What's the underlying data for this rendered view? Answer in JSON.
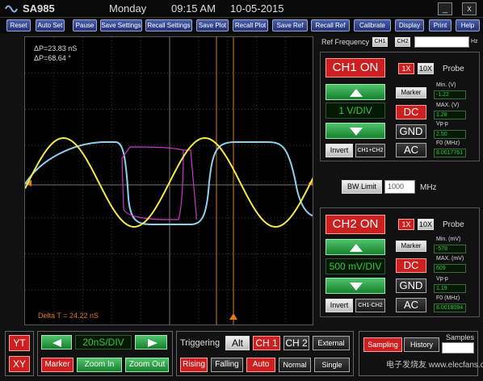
{
  "app": {
    "name": "SA985",
    "day": "Monday",
    "time": "09:15 AM",
    "date": "10-05-2015"
  },
  "window": {
    "minimize": "_",
    "close": "x"
  },
  "toolbar": [
    "Reset",
    "Auto Set",
    "Pause",
    "Save Settings",
    "Recall Settings",
    "Save Plot",
    "Recall Plot",
    "Save Ref",
    "Recall Ref",
    "Calibrate",
    "Display",
    "Print",
    "Help"
  ],
  "scope": {
    "delta_p_time": "ΔP=23.83  nS",
    "delta_p_phase": "ΔP=68.64 °",
    "delta_t": "Delta T = 24.22 nS"
  },
  "ref_frequency": {
    "label": "Ref Frequency",
    "ch1": "CH1",
    "ch2": "CH2",
    "value": "",
    "unit": "Hz"
  },
  "ch1": {
    "on_label": "CH1 ON",
    "probe_1x": "1X",
    "probe_10x": "10X",
    "probe_label": "Probe",
    "volts_div": "1 V/DIV",
    "marker": "Marker",
    "coupling_dc": "DC",
    "coupling_gnd": "GND",
    "coupling_ac": "AC",
    "invert": "Invert",
    "math": "CH1+CH2",
    "min_label": "Min. (V)",
    "min_value": "-1.22",
    "max_label": "MAX. (V)",
    "max_value": "1.28",
    "vpp_label": "Vp-p",
    "vpp_value": "2.50",
    "f0_label": "F0 (MHz)",
    "f0_value": "8.0017761"
  },
  "bw_limit": {
    "label": "BW Limit",
    "value": "1000",
    "unit": "MHz"
  },
  "ch2": {
    "on_label": "CH2 ON",
    "probe_1x": "1X",
    "probe_10x": "10X",
    "probe_label": "Probe",
    "volts_div": "500 mV/DIV",
    "marker": "Marker",
    "coupling_dc": "DC",
    "coupling_gnd": "GND",
    "coupling_ac": "AC",
    "invert": "Invert",
    "math": "CH1-CH2",
    "min_label": "Min. (mV)",
    "min_value": "-578",
    "max_label": "MAX. (mV)",
    "max_value": "609",
    "vpp_label": "Vp-p",
    "vpp_value": "1.19",
    "f0_label": "F0 (MHz)",
    "f0_value": "8.0018094"
  },
  "bottom": {
    "yt": "YT",
    "xy": "XY",
    "timebase": "20nS/DIV",
    "marker": "Marker",
    "zoom_in": "Zoom In",
    "zoom_out": "Zoom Out",
    "triggering_label": "Triggering",
    "alt": "Alt",
    "trig_ch1": "CH 1",
    "trig_ch2": "CH 2",
    "external": "External",
    "rising": "Rising",
    "falling": "Falling",
    "auto": "Auto",
    "normal": "Normal",
    "single": "Single",
    "samples_label": "Samples",
    "sampling": "Sampling",
    "history": "History",
    "watermark": "电子发烧友 www.elecfans.com"
  },
  "colors": {
    "ch1_trace": "#f5e94a",
    "ch2_trace": "#8fd0ee",
    "xy_trace": "#c838c8",
    "cursor": "#e07a1a",
    "accent_red": "#cc1f1f",
    "accent_green": "#2aa84a"
  }
}
